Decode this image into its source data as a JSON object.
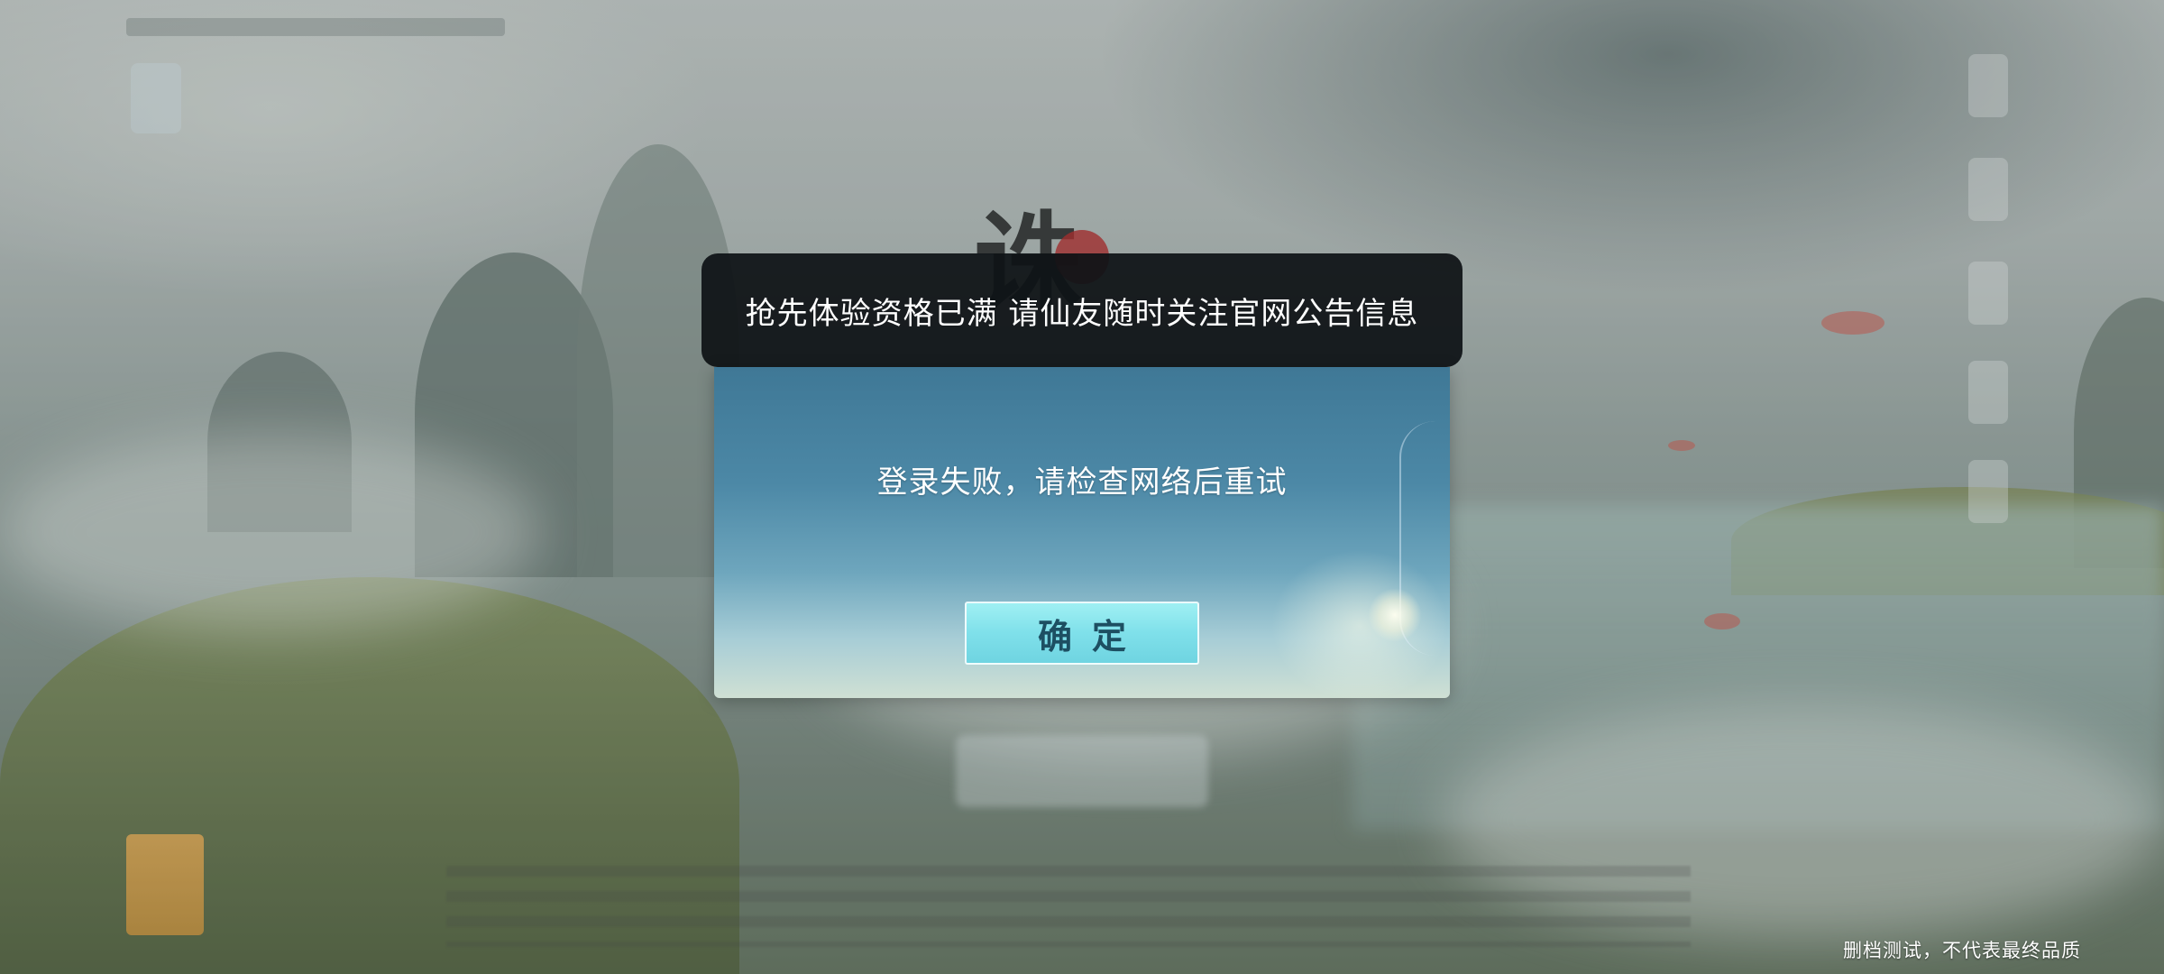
{
  "banner": {
    "text": "抢先体验资格已满 请仙友随时关注官网公告信息"
  },
  "dialog": {
    "message": "登录失败，请检查网络后重试",
    "confirm_label": "确定"
  },
  "footer": {
    "watermark": "删档测试，不代表最终品质"
  },
  "colors": {
    "banner_bg": "#0e1216",
    "dialog_top": "#3f7896",
    "dialog_bottom": "#cfe0d4",
    "button": "#7fe0ea",
    "button_text": "#1d4f62"
  }
}
